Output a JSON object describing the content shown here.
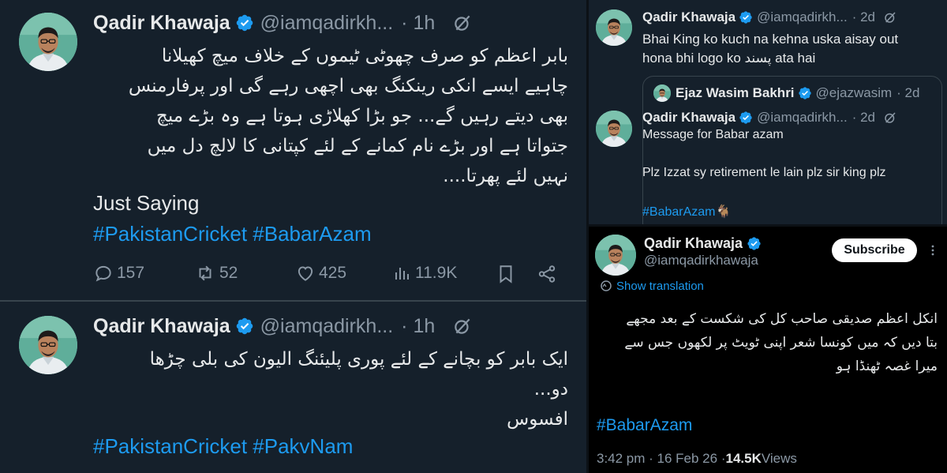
{
  "tweet_main": {
    "name": "Qadir Khawaja",
    "handle": "@iamqadirkh...",
    "time": "· 1h",
    "urdu_lines": [
      "بابر اعظم کو صرف چھوٹی ٹیموں کے خلاف میچ کھیلانا",
      "چاہیے ایسے انکی رینکنگ بھی اچھی رہے گی اور پرفارمنس",
      "بھی دیتے رہیں گے... جو بڑا کھلاڑی ہوتا ہے وہ بڑے میچ",
      "جتواتا ہے اور بڑے نام کمانے کے لئے کپتانی کا لالچ دل میں",
      "نہیں لئے پھرتا...."
    ],
    "english": "Just Saying",
    "hashtags": "#PakistanCricket #BabarAzam",
    "replies": "157",
    "reposts": "52",
    "likes": "425",
    "views": "11.9K"
  },
  "tweet_second": {
    "name": "Qadir Khawaja",
    "handle": "@iamqadirkh...",
    "time": "· 1h",
    "urdu_lines": [
      "ایک بابر کو بچانے کے لئے پوری پلیئنگ الیون کی بلی چڑھا",
      "دو...",
      "افسوس"
    ],
    "hashtags": "#PakistanCricket #PakvNam"
  },
  "tweet_quote": {
    "name": "Qadir Khawaja",
    "handle": "@iamqadirkh...",
    "time": "· 2d",
    "text_line1": "Bhai King ko kuch na kehna uska aisay out",
    "text_line2": "hona bhi logo ko پسند ata hai",
    "quoted_name": "Ejaz Wasim Bakhri",
    "quoted_handle": "@ejazwasim",
    "quoted_time": "· 2d"
  },
  "tweet_message": {
    "name": "Qadir Khawaja",
    "handle": "@iamqadirkh...",
    "time": "· 2d",
    "line1": "Message for Babar azam",
    "line2": "Plz Izzat sy retirement le lain plz sir king plz",
    "hashtag": "#BabarAzam🐐"
  },
  "tweet_detail": {
    "name": "Qadir Khawaja",
    "handle": "@iamqadirkhawaja",
    "subscribe_label": "Subscribe",
    "show_translation": "Show translation",
    "urdu_lines": [
      "انکل اعظم صدیقی صاحب کل کی شکست کے بعد مجھے",
      "بتا دیں کہ میں کونسا شعر اپنی ٹویٹ پر لکھوں جس سے",
      "میرا غصہ ٹھنڈا ہو"
    ],
    "hashtag": "#BabarAzam",
    "timestamp": "3:42 pm · 16 Feb 26 · ",
    "views_count": "14.5K",
    "views_label": " Views"
  },
  "colors": {
    "background_dim": "#15202b",
    "background_black": "#000000",
    "link_blue": "#1d9bf0",
    "verified_blue": "#1d9bf0",
    "muted_gray": "#8b98a5"
  }
}
